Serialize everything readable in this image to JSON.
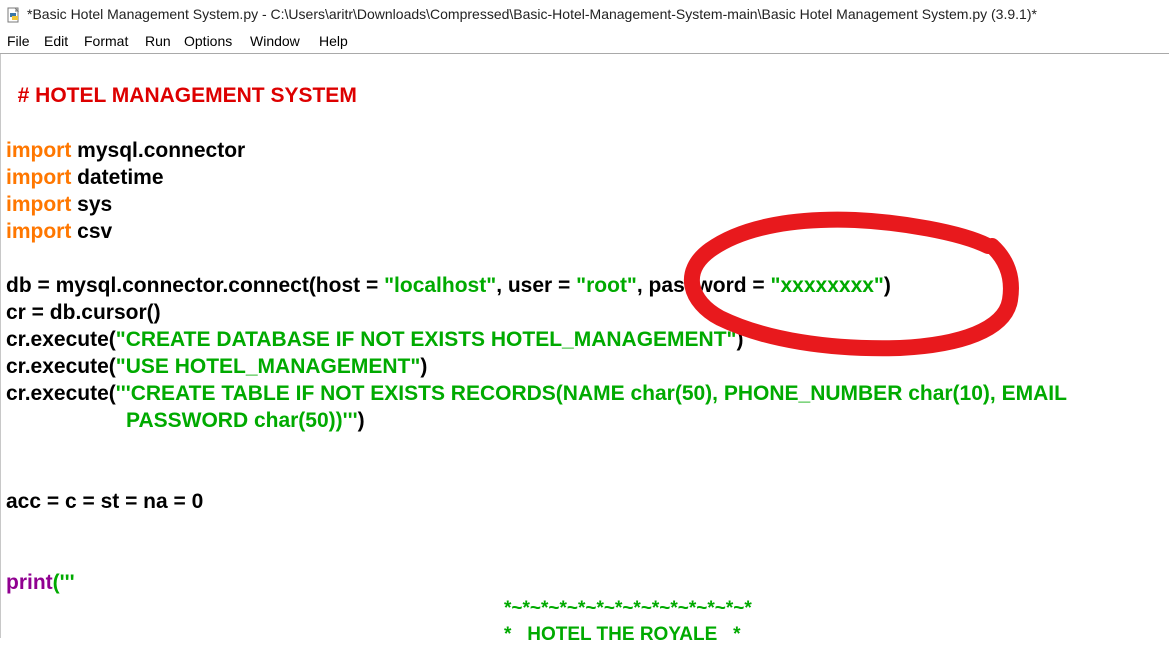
{
  "window": {
    "title": "*Basic Hotel Management System.py - C:\\Users\\aritr\\Downloads\\Compressed\\Basic-Hotel-Management-System-main\\Basic Hotel Management System.py (3.9.1)*",
    "icon": "python-file-icon"
  },
  "menu": {
    "file": "File",
    "edit": "Edit",
    "format": "Format",
    "run": "Run",
    "options": "Options",
    "window": "Window",
    "help": "Help"
  },
  "code": {
    "comment_title": "# HOTEL MANAGEMENT SYSTEM",
    "import_kw": "import",
    "import1_mod": " mysql.connector",
    "import2_mod": " datetime",
    "import3_mod": " sys",
    "import4_mod": " csv",
    "db_part1": "db = mysql.connector.connect(host = ",
    "db_host": "\"localhost\"",
    "db_part2": ", user = ",
    "db_user": "\"root\"",
    "db_part3": ", password = ",
    "db_password": "\"xxxxxxxx\"",
    "db_part4": ")",
    "cursor_line": "cr = db.cursor()",
    "exec_prefix": "cr.execute(",
    "exec1_str": "\"CREATE DATABASE IF NOT EXISTS HOTEL_MANAGEMENT\"",
    "exec1_end": ")",
    "exec2_str": "\"USE HOTEL_MANAGEMENT\"",
    "exec2_end": ")",
    "exec3_str": "'''CREATE TABLE IF NOT EXISTS RECORDS(NAME char(50), PHONE_NUMBER char(10), EMAIL",
    "exec3_cont": "PASSWORD char(50))'''",
    "exec3_end": ")",
    "acc_line": "acc = c = st = na = 0",
    "print_kw": "print",
    "print_open": "('''",
    "banner1": "*~*~*~*~*~*~*~*~*~*~*~*~*~*",
    "banner2": "*   HOTEL THE ROYALE   *"
  },
  "annotation": {
    "color": "#e8191d"
  }
}
